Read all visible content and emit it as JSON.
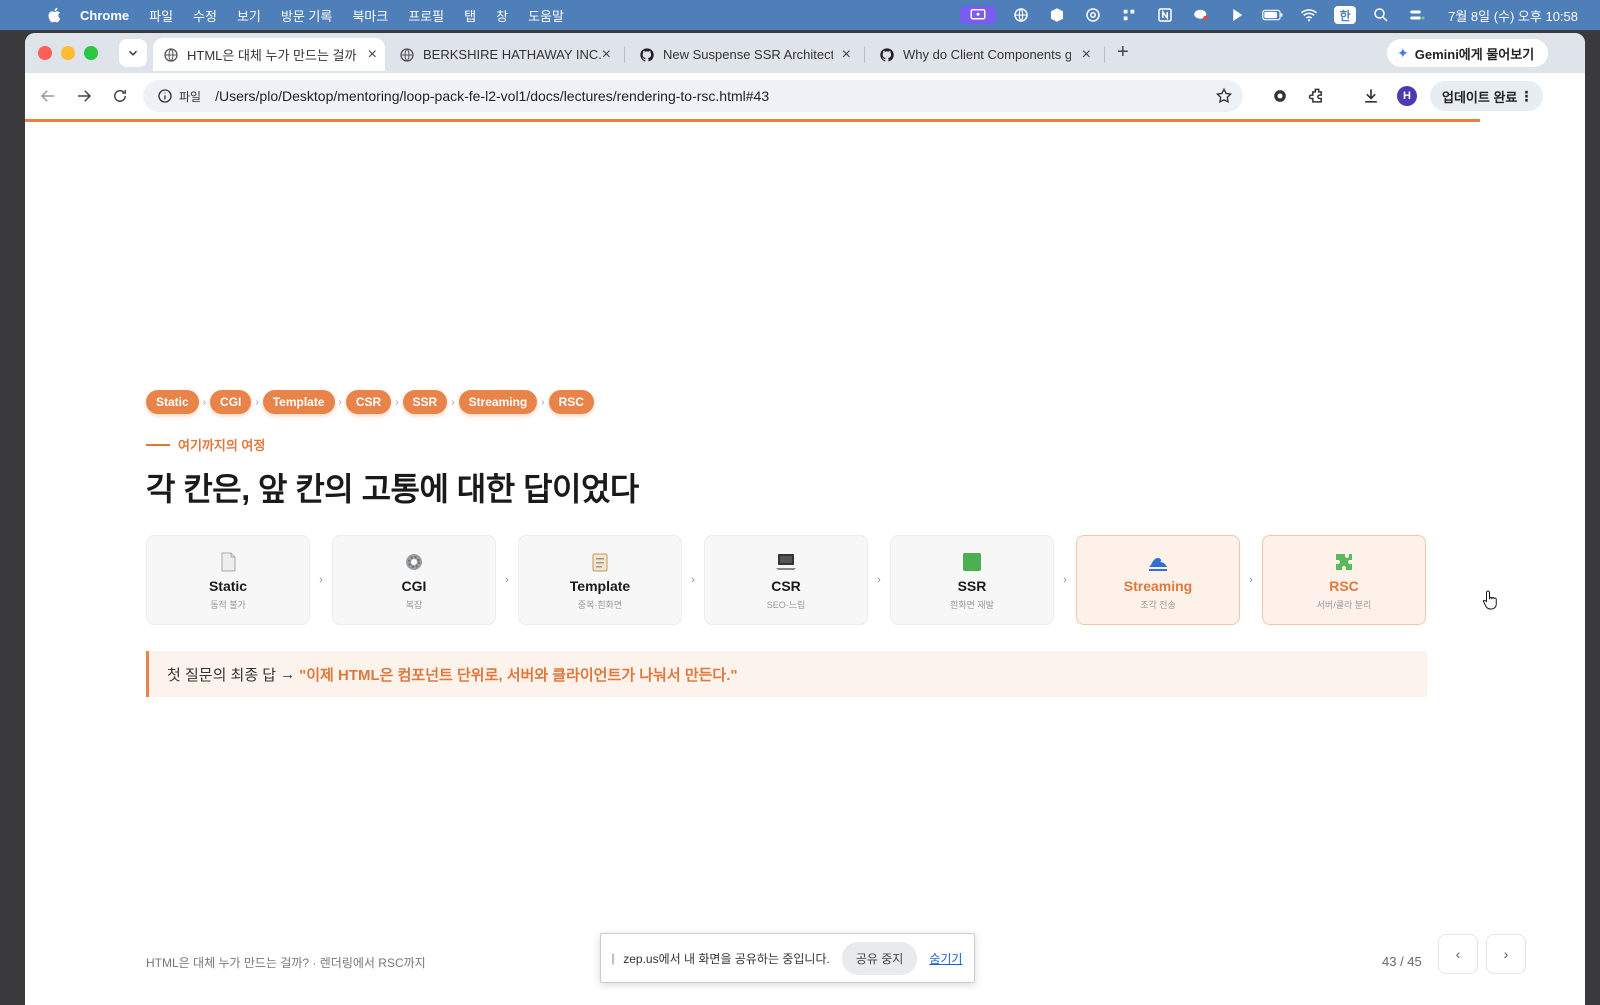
{
  "menubar": {
    "app": "Chrome",
    "menus": [
      "파일",
      "수정",
      "보기",
      "방문 기록",
      "북마크",
      "프로필",
      "탭",
      "창",
      "도움말"
    ],
    "ime": "한",
    "clock": "7월 8일 (수) 오후 10:58"
  },
  "tabs": [
    {
      "title": "HTML은 대체 누가 만드는 걸까? -",
      "icon": "globe-icon",
      "active": true
    },
    {
      "title": "BERKSHIRE HATHAWAY INC.",
      "icon": "globe-icon"
    },
    {
      "title": "New Suspense SSR Architect",
      "icon": "github-icon"
    },
    {
      "title": "Why do Client Components g",
      "icon": "github-icon"
    }
  ],
  "gemini": {
    "label": "Gemini에게 물어보기"
  },
  "omnibox": {
    "chip": "파일",
    "url": "/Users/plo/Desktop/mentoring/loop-pack-fe-l2-vol1/docs/lectures/rendering-to-rsc.html#43"
  },
  "profile": {
    "initial": "H"
  },
  "update": {
    "label": "업데이트 완료"
  },
  "slide": {
    "pills": [
      "Static",
      "CGI",
      "Template",
      "CSR",
      "SSR",
      "Streaming",
      "RSC"
    ],
    "kicker": "여기까지의 여정",
    "headline": "각 칸은, 앞 칸의 고통에 대한 답이었다",
    "cards": [
      {
        "name": "Static",
        "sub": "동적 불가",
        "icon": "document-icon"
      },
      {
        "name": "CGI",
        "sub": "복잡",
        "icon": "gear-icon"
      },
      {
        "name": "Template",
        "sub": "중복·흰화면",
        "icon": "clipboard-icon"
      },
      {
        "name": "CSR",
        "sub": "SEO·느림",
        "icon": "laptop-icon"
      },
      {
        "name": "SSR",
        "sub": "흰화면 재발",
        "icon": "green-square-icon"
      },
      {
        "name": "Streaming",
        "sub": "조각 전송",
        "icon": "wave-icon",
        "highlight": true
      },
      {
        "name": "RSC",
        "sub": "서버/클라 분리",
        "icon": "puzzle-icon",
        "highlight": true
      }
    ],
    "callout": {
      "prefix": "첫 질문의 최종 답",
      "arrow": "→",
      "quote": "\"이제 HTML은 컴포넌트 단위로, 서버와 클라이언트가 나눠서 만든다.\""
    },
    "footer": "HTML은 대체 누가 만드는 걸까? · 렌더링에서 RSC까지",
    "page": "43 / 45",
    "prev": "‹",
    "next": "›"
  },
  "share_banner": {
    "message": "zep.us에서 내 화면을 공유하는 중입니다.",
    "stop": "공유 중지",
    "hide": "숨기기"
  },
  "colors": {
    "accent": "#e8834a",
    "menubar": "#4f7fb8",
    "avatar": "#4a3bb0"
  }
}
